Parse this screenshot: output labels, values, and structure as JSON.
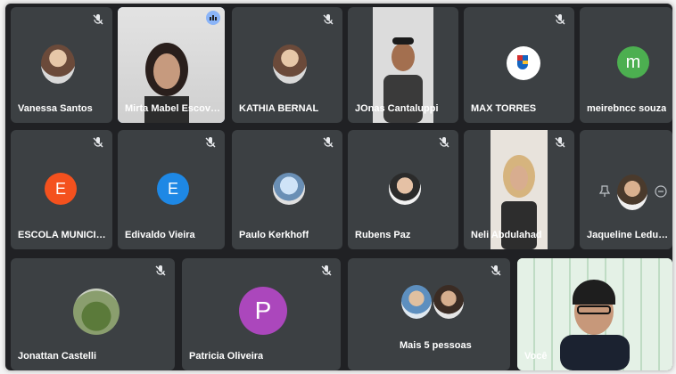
{
  "participants": [
    {
      "name": "Vanessa Santos",
      "muted": true
    },
    {
      "name": "Mirta Mabel Escovar T...",
      "muted": false
    },
    {
      "name": "KATHIA BERNAL",
      "muted": true
    },
    {
      "name": "JOnas Cantaluppi",
      "muted": false
    },
    {
      "name": "MAX TORRES",
      "muted": true
    },
    {
      "name": "meirebncc souza",
      "initial": "m",
      "color": "#4caf50",
      "muted": false
    },
    {
      "name": "ESCOLA MUNICIPAL IG...",
      "initial": "E",
      "color": "#f4511e",
      "muted": true
    },
    {
      "name": "Edivaldo Vieira",
      "initial": "E",
      "color": "#1e88e5",
      "muted": true
    },
    {
      "name": "Paulo Kerkhoff",
      "muted": true
    },
    {
      "name": "Rubens Paz",
      "muted": true
    },
    {
      "name": "Neli Abdulahad",
      "muted": true
    },
    {
      "name": "Jaqueline Ledur - Pont...",
      "muted": false
    },
    {
      "name": "Jonattan Castelli",
      "muted": true
    },
    {
      "name": "Patricia Oliveira",
      "initial": "P",
      "color": "#ab47bc",
      "muted": true
    },
    {
      "name": "Mais 5 pessoas",
      "muted": true
    },
    {
      "name": "Você",
      "muted": false
    }
  ],
  "colors": {
    "background": "#202124",
    "tile": "#3c4043",
    "active_outline": "#8ab4f8"
  }
}
